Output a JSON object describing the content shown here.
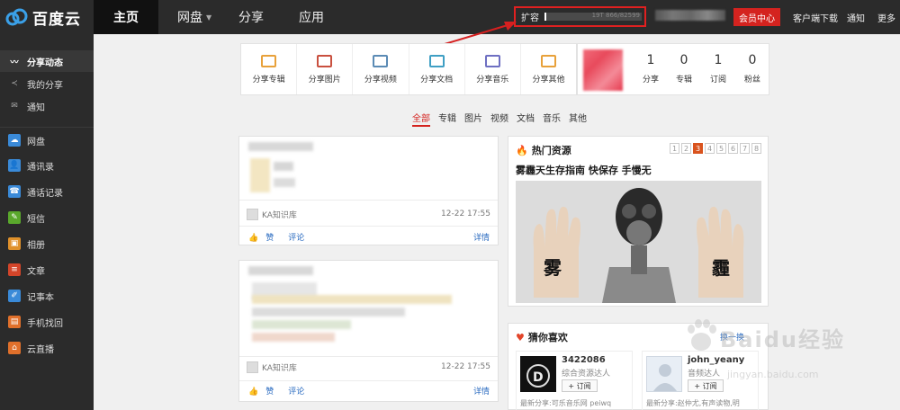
{
  "app": {
    "name": "百度云"
  },
  "topnav": {
    "home": "主页",
    "netdisk": "网盘",
    "share": "分享",
    "apps": "应用"
  },
  "quota": {
    "label": "扩容",
    "text": "19T 866/82599",
    "used_fraction": 0.02
  },
  "toplinks": {
    "vip": "会员中心",
    "client": "客户端下载",
    "notify": "通知",
    "more": "更多"
  },
  "sidebar": {
    "items": [
      {
        "label": "分享动态",
        "icon": "activity-icon",
        "color": "#2b2b2b"
      },
      {
        "label": "我的分享",
        "icon": "share-icon",
        "color": "#2b2b2b"
      },
      {
        "label": "通知",
        "icon": "mail-icon",
        "color": "#2b2b2b"
      },
      {
        "label": "网盘",
        "icon": "cloud-icon",
        "color": "#3a8ad8"
      },
      {
        "label": "通讯录",
        "icon": "contacts-icon",
        "color": "#3a8ad8"
      },
      {
        "label": "通话记录",
        "icon": "phone-icon",
        "color": "#3a8ad8"
      },
      {
        "label": "短信",
        "icon": "sms-icon",
        "color": "#5aa82c"
      },
      {
        "label": "相册",
        "icon": "photo-icon",
        "color": "#e0912b"
      },
      {
        "label": "文章",
        "icon": "article-icon",
        "color": "#d4452a"
      },
      {
        "label": "记事本",
        "icon": "notepad-icon",
        "color": "#3a8ad8"
      },
      {
        "label": "手机找回",
        "icon": "find-phone-icon",
        "color": "#e0702b"
      },
      {
        "label": "云直播",
        "icon": "live-icon",
        "color": "#e0702b"
      }
    ]
  },
  "share_types": [
    {
      "label": "分享专辑",
      "icon": "album-icon",
      "color": "#e8a13a"
    },
    {
      "label": "分享图片",
      "icon": "picture-icon",
      "color": "#c9503f"
    },
    {
      "label": "分享视频",
      "icon": "video-icon",
      "color": "#5b8bb5"
    },
    {
      "label": "分享文档",
      "icon": "document-icon",
      "color": "#3f9fc4"
    },
    {
      "label": "分享音乐",
      "icon": "music-icon",
      "color": "#6e6fc2"
    },
    {
      "label": "分享其他",
      "icon": "other-icon",
      "color": "#e8a13a"
    }
  ],
  "stats": [
    {
      "value": "1",
      "label": "分享"
    },
    {
      "value": "0",
      "label": "专辑"
    },
    {
      "value": "1",
      "label": "订阅"
    },
    {
      "value": "0",
      "label": "粉丝"
    }
  ],
  "filter_tabs": [
    "全部",
    "专辑",
    "图片",
    "视频",
    "文档",
    "音乐",
    "其他"
  ],
  "feed": [
    {
      "author": "KA知识库",
      "time": "12-22 17:55",
      "like": "赞",
      "comment": "评论",
      "detail": "详情"
    },
    {
      "author": "KA知识库",
      "time": "12-22 17:55",
      "like": "赞",
      "comment": "评论",
      "detail": "详情"
    }
  ],
  "hot": {
    "title": "热门资源",
    "pages": [
      "1",
      "2",
      "3",
      "4",
      "5",
      "6",
      "7",
      "8"
    ],
    "active_page": "3",
    "headline": "雾霾天生存指南 快保存 手慢无",
    "left_palm": "雾",
    "right_palm": "霾"
  },
  "guess": {
    "title": "猜你喜欢",
    "refresh": "换一换",
    "items": [
      {
        "name": "3422086",
        "role": "综合资源达人",
        "subscribe": "+ 订阅",
        "latest": "最新分享:可乐音乐网 peiwq"
      },
      {
        "name": "john_yeany",
        "role": "音频达人",
        "subscribe": "+ 订阅",
        "latest": "最新分享:赵仲尤,有声读物,明"
      }
    ]
  },
  "watermark": {
    "text": "Baidu经验",
    "url": "jingyan.baidu.com"
  }
}
